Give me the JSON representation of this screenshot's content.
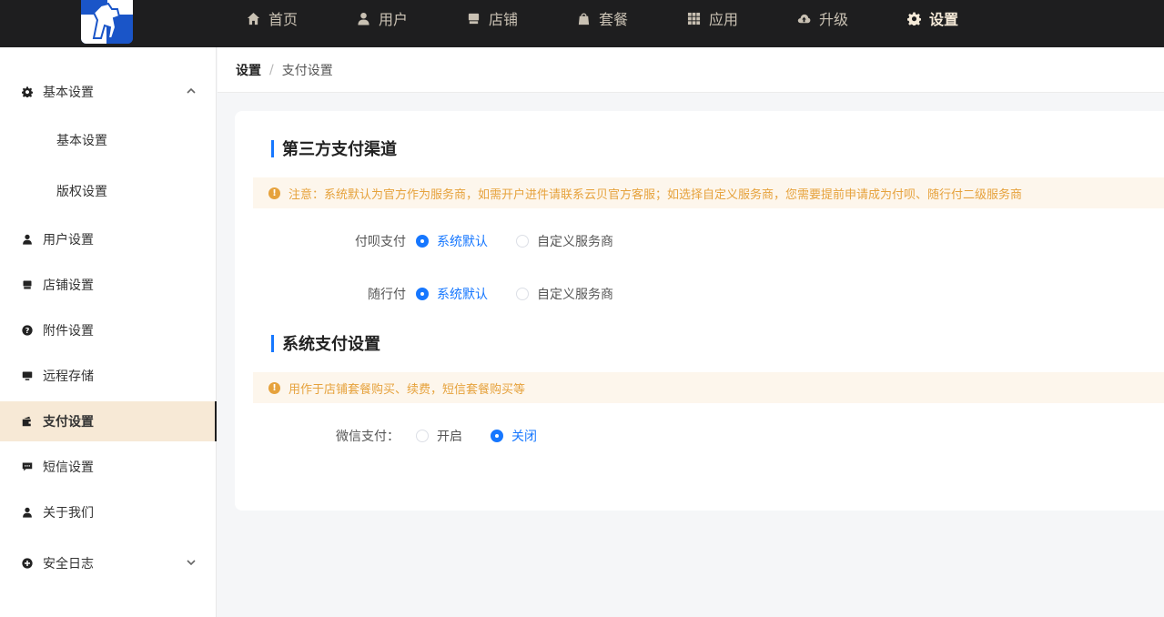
{
  "topnav": {
    "items": [
      {
        "label": "首页",
        "icon": "home-icon"
      },
      {
        "label": "用户",
        "icon": "user-icon"
      },
      {
        "label": "店铺",
        "icon": "store-icon"
      },
      {
        "label": "套餐",
        "icon": "bag-icon"
      },
      {
        "label": "应用",
        "icon": "grid-icon"
      },
      {
        "label": "升级",
        "icon": "cloud-upload-icon"
      },
      {
        "label": "设置",
        "icon": "gear-icon",
        "active": true
      }
    ]
  },
  "sidebar": {
    "items": [
      {
        "label": "基本设置",
        "icon": "gear-icon",
        "expanded": true
      },
      {
        "label": "基本设置"
      },
      {
        "label": "版权设置"
      },
      {
        "label": "用户设置",
        "icon": "user-icon"
      },
      {
        "label": "店铺设置",
        "icon": "store-icon"
      },
      {
        "label": "附件设置",
        "icon": "question-icon"
      },
      {
        "label": "远程存储",
        "icon": "monitor-icon"
      },
      {
        "label": "支付设置",
        "icon": "wallet-icon",
        "active": true
      },
      {
        "label": "短信设置",
        "icon": "message-icon"
      },
      {
        "label": "关于我们",
        "icon": "user-icon"
      },
      {
        "label": "安全日志",
        "icon": "plus-circle-icon",
        "expanded": false
      }
    ]
  },
  "breadcrumb": {
    "root": "设置",
    "separator": "/",
    "current": "支付设置"
  },
  "sections": {
    "third_party": {
      "title": "第三方支付渠道",
      "notice": "注意：系统默认为官方作为服务商，如需开户进件请联系云贝官方客服；如选择自定义服务商，您需要提前申请成为付呗、随行付二级服务商",
      "rows": [
        {
          "label": "付呗支付",
          "options": [
            "系统默认",
            "自定义服务商"
          ],
          "selected": "系统默认"
        },
        {
          "label": "随行付",
          "options": [
            "系统默认",
            "自定义服务商"
          ],
          "selected": "系统默认"
        }
      ]
    },
    "system_pay": {
      "title": "系统支付设置",
      "notice": "用作于店铺套餐购买、续费，短信套餐购买等",
      "rows": [
        {
          "label": "微信支付：",
          "options": [
            "开启",
            "关闭"
          ],
          "selected": "关闭"
        }
      ]
    }
  },
  "colors": {
    "accent": "#1677ff",
    "topbar": "#1e1e1f",
    "warning": "#e6a23c",
    "active_bg": "#f7e9d6"
  }
}
